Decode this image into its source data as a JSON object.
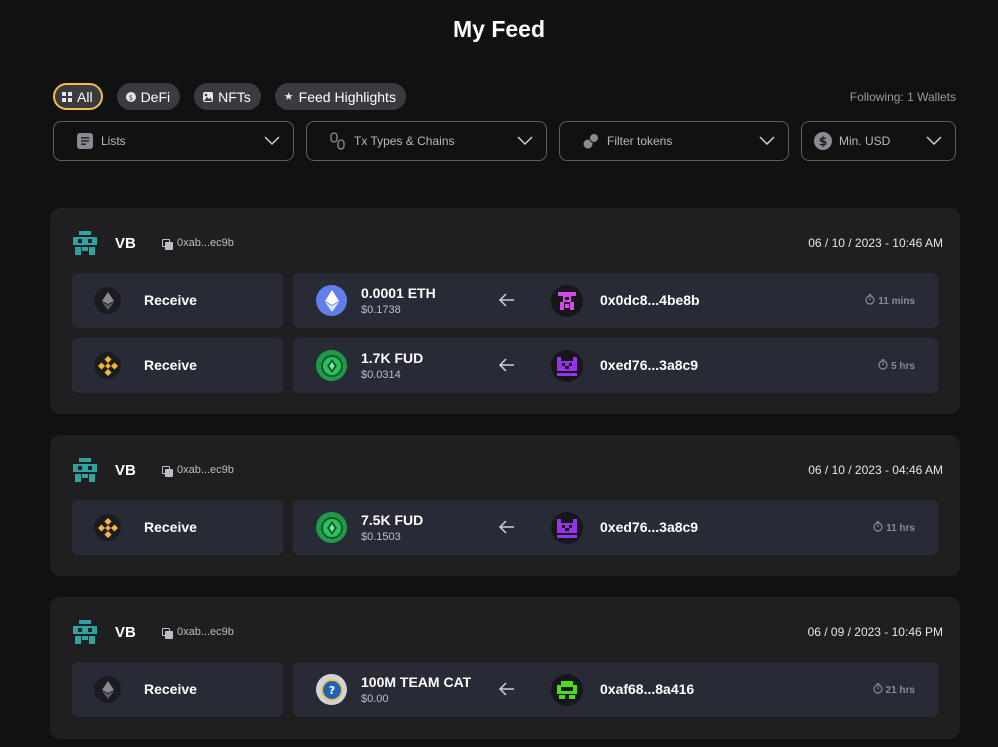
{
  "page": {
    "title": "My Feed"
  },
  "chips": [
    {
      "label": "All",
      "icon": "grid-icon",
      "active": true
    },
    {
      "label": "DeFi",
      "icon": "coin-icon",
      "active": false
    },
    {
      "label": "NFTs",
      "icon": "image-icon",
      "active": false
    },
    {
      "label": "Feed Highlights",
      "icon": "star-icon",
      "active": false
    }
  ],
  "following": "Following: 1 Wallets",
  "filters": {
    "lists": "Lists",
    "tx_types": "Tx Types & Chains",
    "tokens": "Filter tokens",
    "min_usd": "Min. USD"
  },
  "cards": [
    {
      "wallet": "VB",
      "address": "0xab...ec9b",
      "date": "06 / 10 / 2023 - 10:46 AM",
      "txs": [
        {
          "type": "Receive",
          "chain": "ethereum-icon",
          "amount": "0.0001 ETH",
          "usd": "$0.1738",
          "peer": "0x0dc8...4be8b",
          "elapsed": "11 mins"
        },
        {
          "type": "Receive",
          "chain": "bnb-chain-icon",
          "amount": "1.7K FUD",
          "usd": "$0.0314",
          "peer": "0xed76...3a8c9",
          "elapsed": "5 hrs"
        }
      ]
    },
    {
      "wallet": "VB",
      "address": "0xab...ec9b",
      "date": "06 / 10 / 2023 - 04:46 AM",
      "txs": [
        {
          "type": "Receive",
          "chain": "bnb-chain-icon",
          "amount": "7.5K FUD",
          "usd": "$0.1503",
          "peer": "0xed76...3a8c9",
          "elapsed": "11 hrs"
        }
      ]
    },
    {
      "wallet": "VB",
      "address": "0xab...ec9b",
      "date": "06 / 09 / 2023 - 10:46 PM",
      "txs": [
        {
          "type": "Receive",
          "chain": "ethereum-icon",
          "amount": "100M TEAM CAT",
          "usd": "$0.00",
          "peer": "0xaf68...8a416",
          "elapsed": "21 hrs"
        }
      ]
    }
  ],
  "colors": {
    "background": "#111111",
    "card": "#1f1f22",
    "row": "#282a35",
    "accent_active": "#f1c04b",
    "wallet_avatar": "#2fa3a0",
    "bnb": "#f3ba2f",
    "fud": "#1f9a4a"
  }
}
